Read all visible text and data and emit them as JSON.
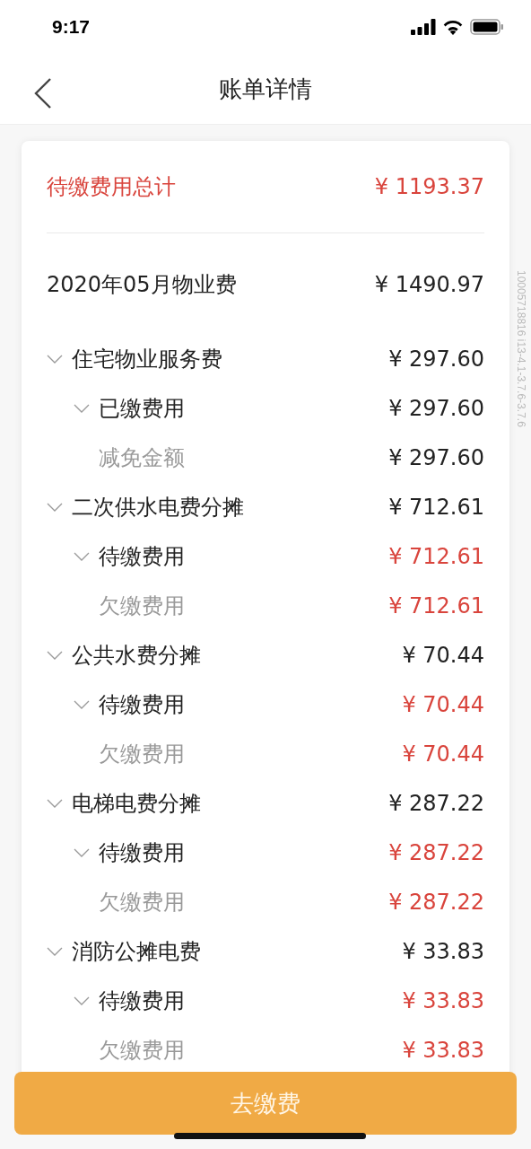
{
  "status_bar": {
    "time": "9:17"
  },
  "nav": {
    "title": "账单详情"
  },
  "total": {
    "label": "待缴费用总计",
    "amount": "¥ 1193.37"
  },
  "bill": {
    "title": "2020年05月物业费",
    "amount": "¥ 1490.97"
  },
  "items": [
    {
      "label": "住宅物业服务费",
      "amount": "¥ 297.60",
      "unpaid": false,
      "expanded": true,
      "children": [
        {
          "label": "已缴费用",
          "amount": "¥ 297.60",
          "unpaid": false,
          "expanded": true,
          "children": [
            {
              "label": "减免金额",
              "amount": "¥ 297.60",
              "unpaid": false
            }
          ]
        }
      ]
    },
    {
      "label": "二次供水电费分摊",
      "amount": "¥ 712.61",
      "unpaid": false,
      "expanded": true,
      "children": [
        {
          "label": "待缴费用",
          "amount": "¥ 712.61",
          "unpaid": true,
          "expanded": true,
          "children": [
            {
              "label": "欠缴费用",
              "amount": "¥ 712.61",
              "unpaid": true
            }
          ]
        }
      ]
    },
    {
      "label": "公共水费分摊",
      "amount": "¥ 70.44",
      "unpaid": false,
      "expanded": true,
      "children": [
        {
          "label": "待缴费用",
          "amount": "¥ 70.44",
          "unpaid": true,
          "expanded": true,
          "children": [
            {
              "label": "欠缴费用",
              "amount": "¥ 70.44",
              "unpaid": true
            }
          ]
        }
      ]
    },
    {
      "label": "电梯电费分摊",
      "amount": "¥ 287.22",
      "unpaid": false,
      "expanded": true,
      "children": [
        {
          "label": "待缴费用",
          "amount": "¥ 287.22",
          "unpaid": true,
          "expanded": true,
          "children": [
            {
              "label": "欠缴费用",
              "amount": "¥ 287.22",
              "unpaid": true
            }
          ]
        }
      ]
    },
    {
      "label": "消防公摊电费",
      "amount": "¥ 33.83",
      "unpaid": false,
      "expanded": true,
      "children": [
        {
          "label": "待缴费用",
          "amount": "¥ 33.83",
          "unpaid": true,
          "expanded": true,
          "children": [
            {
              "label": "欠缴费用",
              "amount": "¥ 33.83",
              "unpaid": true
            }
          ]
        }
      ]
    }
  ],
  "side_code": "10005718816 i13-4.1-3.7.6-3.7.6",
  "pay_button": {
    "label": "去缴费"
  }
}
